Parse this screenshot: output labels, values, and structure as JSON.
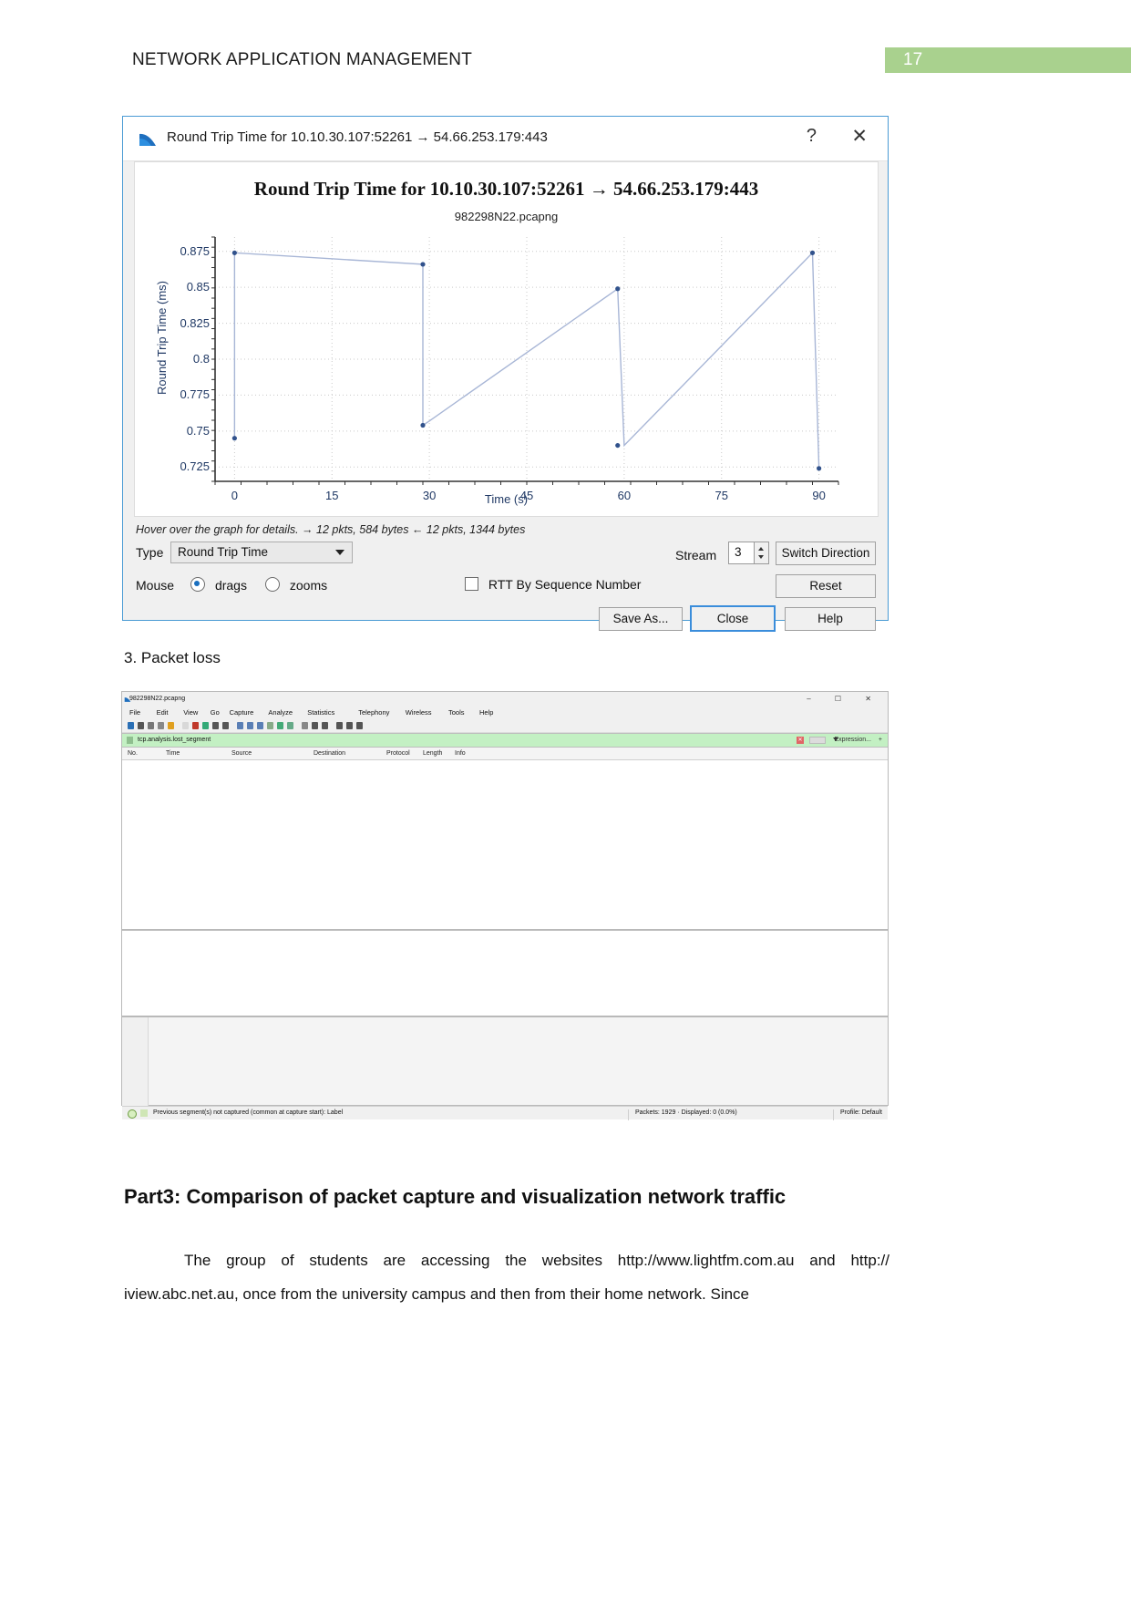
{
  "document": {
    "header_title": "NETWORK APPLICATION MANAGEMENT",
    "page_number": "17",
    "accent_green": "#a9d18e",
    "caption_packet_loss": "3. Packet loss",
    "part3_heading": "Part3: Comparison of packet capture and visualization network traffic",
    "body_paragraph": "The group of students are accessing the websites http://www.lightfm.com.au and http:// iview.abc.net.au, once from the university campus and then from their home network. Since"
  },
  "rtt_dialog": {
    "title": "Round Trip Time for 10.10.30.107:52261 → 54.66.253.179:443",
    "help_icon": "?",
    "close_icon": "✕",
    "hint_text": "Hover over the graph for details. → 12 pkts, 584 bytes ← 12 pkts, 1344 bytes",
    "type_label": "Type",
    "type_value": "Round Trip Time",
    "stream_label": "Stream",
    "stream_value": "3",
    "switch_direction_label": "Switch Direction",
    "mouse_label": "Mouse",
    "mouse_drags_label": "drags",
    "mouse_zooms_label": "zooms",
    "mouse_selected": "drags",
    "rtt_by_seq_label": "RTT By Sequence Number",
    "rtt_by_seq_checked": false,
    "reset_label": "Reset",
    "save_as_label": "Save As...",
    "close_label": "Close",
    "help_label": "Help"
  },
  "chart_data": {
    "type": "scatter",
    "title": "Round Trip Time for 10.10.30.107:52261 → 54.66.253.179:443",
    "subtitle": "982298N22.pcapng",
    "xlabel": "Time (s)",
    "ylabel": "Round Trip Time (ms)",
    "xlim": [
      -3,
      93
    ],
    "ylim": [
      0.715,
      0.885
    ],
    "xticks": [
      "0",
      "15",
      "30",
      "45",
      "60",
      "75",
      "90"
    ],
    "xtick_values": [
      0,
      15,
      30,
      45,
      60,
      75,
      90
    ],
    "yticks": [
      "0.875",
      "0.85",
      "0.825",
      "0.8",
      "0.775",
      "0.75",
      "0.725"
    ],
    "ytick_values": [
      0.875,
      0.85,
      0.825,
      0.8,
      0.775,
      0.75,
      0.725
    ],
    "grid": true,
    "legend": "none",
    "point_color": "#31528c",
    "line_color": "#a8b6d6",
    "series": [
      {
        "name": "Round Trip Time",
        "x": [
          0,
          0,
          29,
          29,
          30,
          59,
          59,
          60,
          89,
          89,
          90
        ],
        "y": [
          0.745,
          0.874,
          0.866,
          0.754,
          0.757,
          0.849,
          0.849,
          0.74,
          0.874,
          0.874,
          0.724
        ]
      }
    ],
    "points": [
      {
        "x": 0,
        "y": 0.745
      },
      {
        "x": 0,
        "y": 0.874
      },
      {
        "x": 29,
        "y": 0.866
      },
      {
        "x": 29,
        "y": 0.754
      },
      {
        "x": 59,
        "y": 0.849
      },
      {
        "x": 59,
        "y": 0.74
      },
      {
        "x": 89,
        "y": 0.874
      },
      {
        "x": 90,
        "y": 0.724
      }
    ]
  },
  "wireshark_main": {
    "file_name": "982298N22.pcapng",
    "window_buttons": [
      "–",
      "❐",
      "✕"
    ],
    "menu": [
      "File",
      "Edit",
      "View",
      "Go",
      "Capture",
      "Analyze",
      "Statistics",
      "Telephony",
      "Wireless",
      "Tools",
      "Help"
    ],
    "filter_value": "tcp.analysis.lost_segment",
    "filter_expression_label": "Expression...",
    "filter_plus_label": "+",
    "columns": [
      "No.",
      "Time",
      "Source",
      "Destination",
      "Protocol",
      "Length",
      "Info"
    ],
    "status_left": "Previous segment(s) not captured (common at capture start): Label",
    "status_packets": "Packets: 1929 · Displayed: 0 (0.0%)",
    "status_profile": "Profile: Default"
  }
}
